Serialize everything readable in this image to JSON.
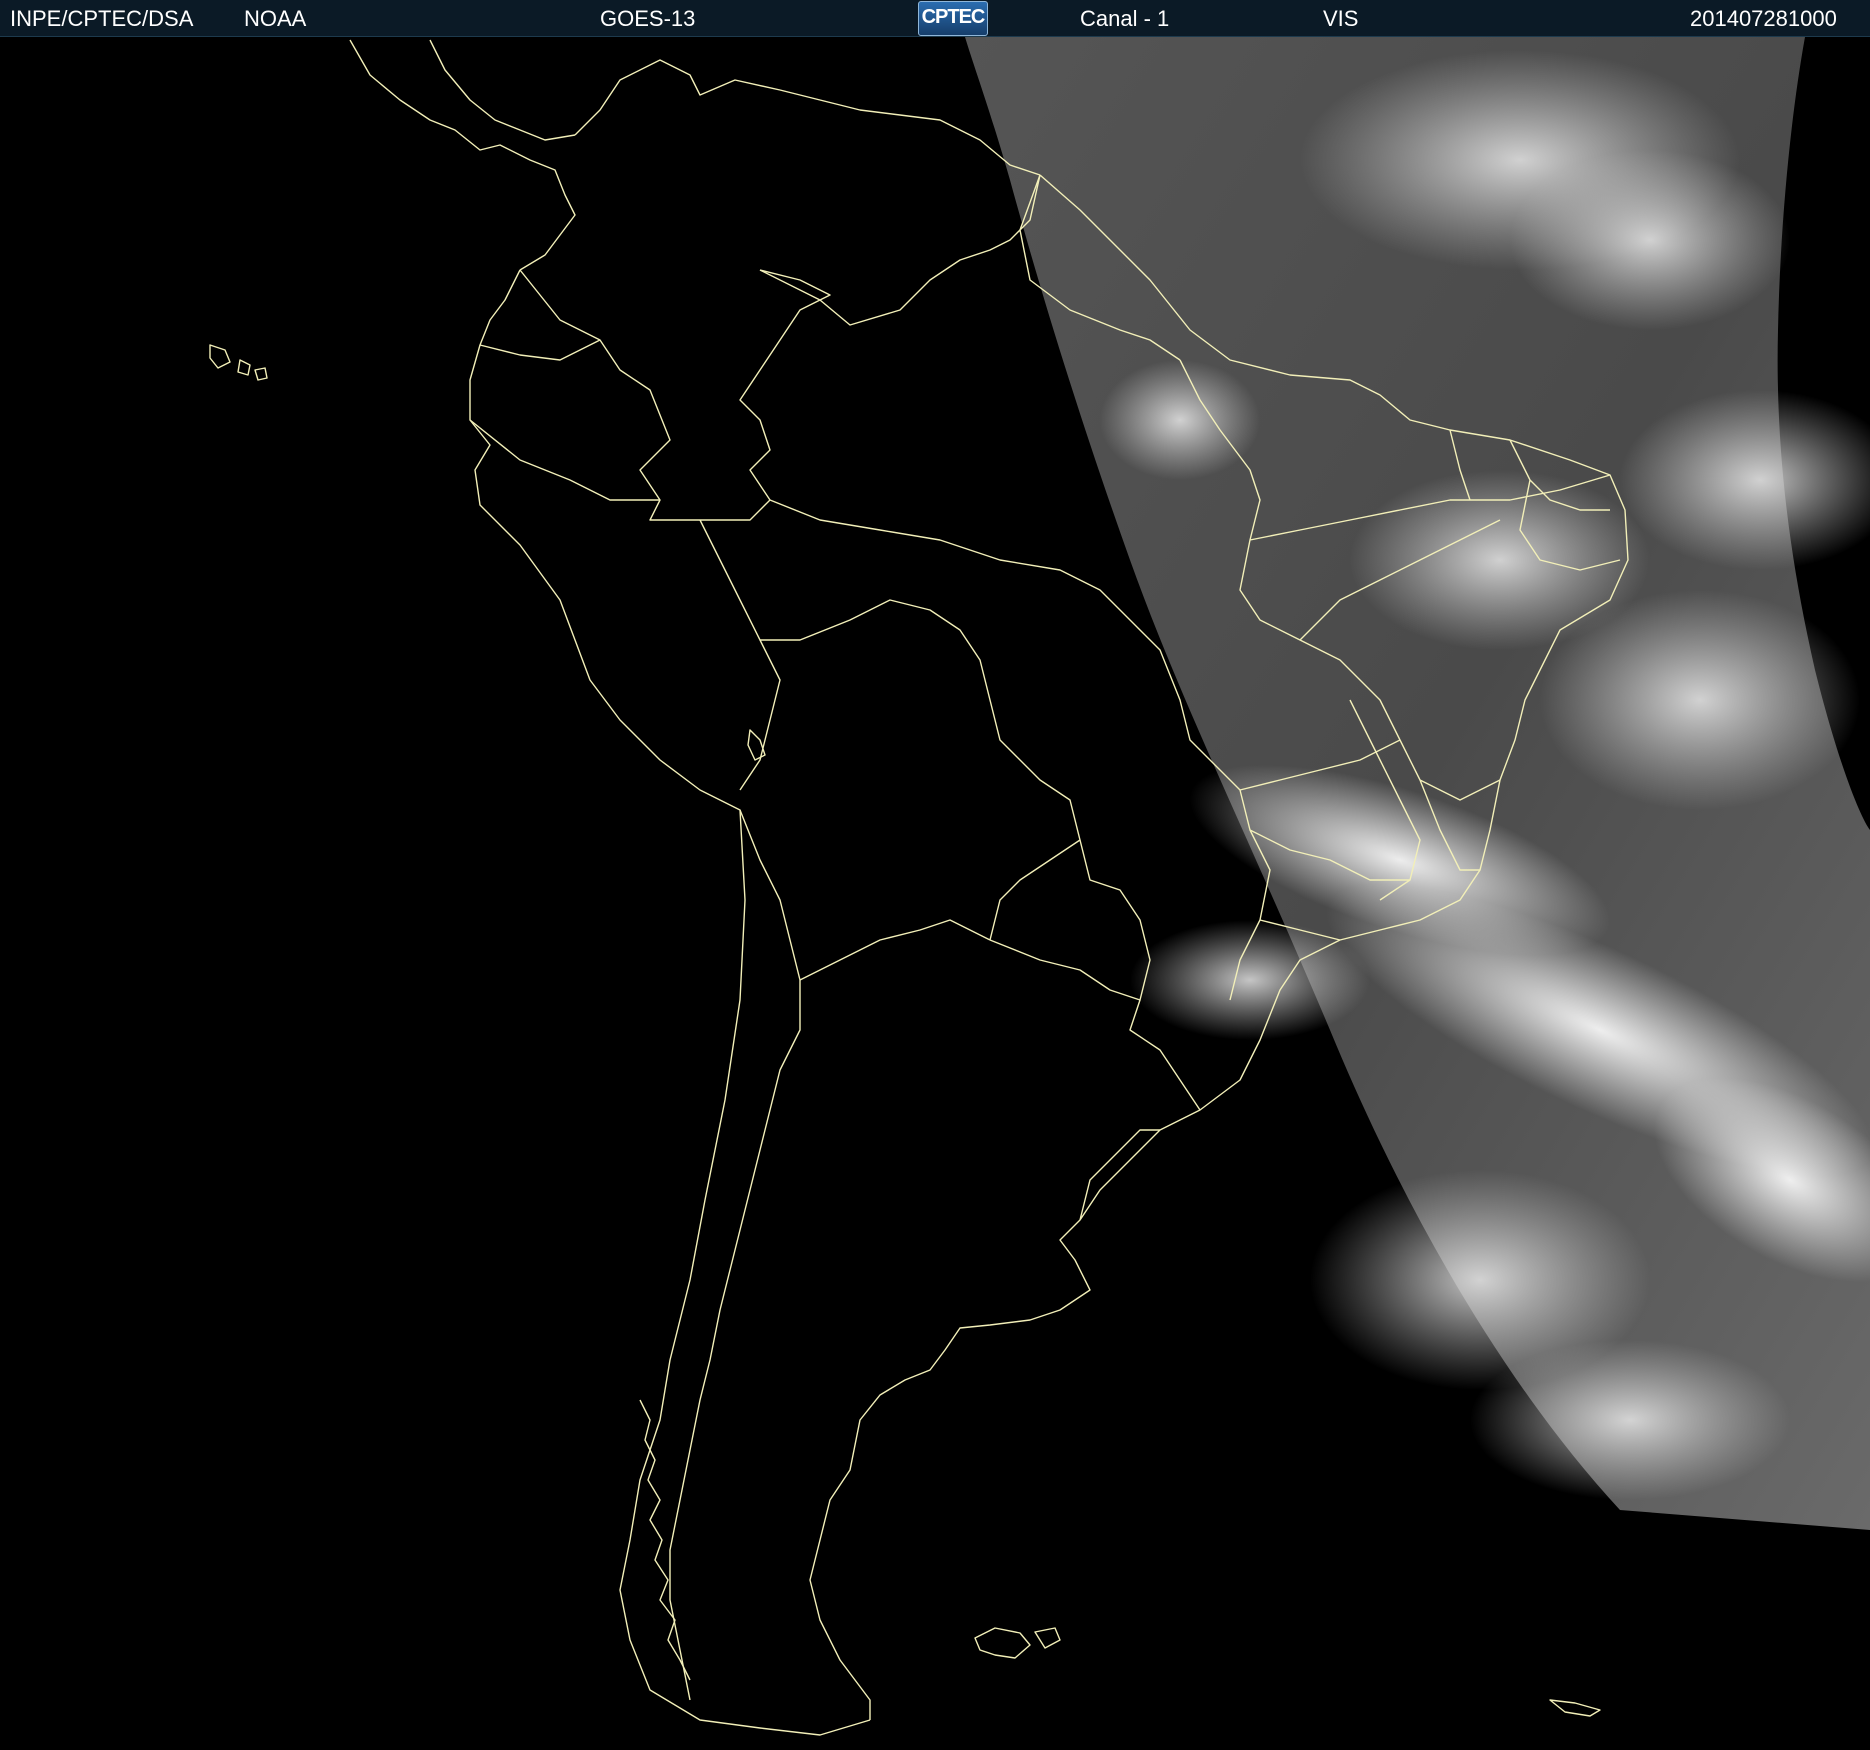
{
  "header": {
    "agency": "INPE/CPTEC/DSA",
    "source": "NOAA",
    "satellite": "GOES-13",
    "logo_text": "CPTEC",
    "channel": "Canal - 1",
    "band": "VIS",
    "timestamp": "201407281000"
  },
  "colors": {
    "background": "#000000",
    "border_lines": "#f2efb8",
    "header_bg": "#0b1a26",
    "header_text": "#ffffff"
  }
}
